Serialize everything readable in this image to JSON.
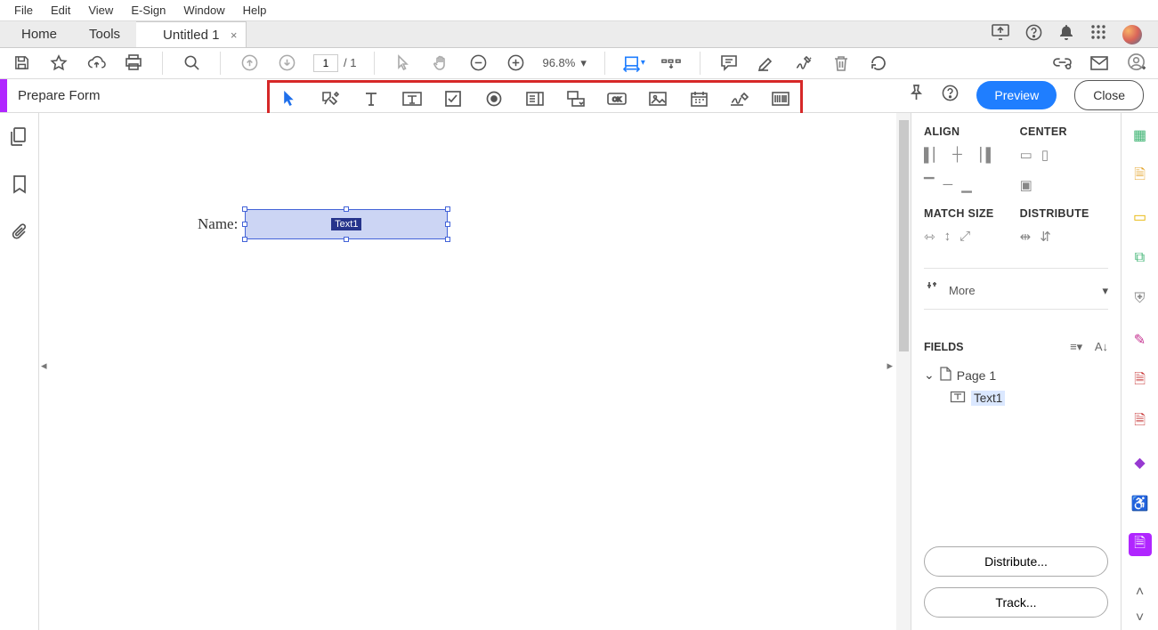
{
  "menu": {
    "file": "File",
    "edit": "Edit",
    "view": "View",
    "esign": "E-Sign",
    "window": "Window",
    "help": "Help"
  },
  "tabs": {
    "home": "Home",
    "tools": "Tools",
    "doc": "Untitled 1"
  },
  "toolbar": {
    "page_current": "1",
    "page_total": "/  1",
    "zoom": "96.8%"
  },
  "form": {
    "title": "Prepare Form",
    "preview": "Preview",
    "close": "Close"
  },
  "canvas": {
    "label": "Name:",
    "field_tag": "Text1"
  },
  "panel": {
    "align": "ALIGN",
    "center": "CENTER",
    "match": "MATCH SIZE",
    "distribute": "DISTRIBUTE",
    "more": "More",
    "fields": "FIELDS",
    "page": "Page 1",
    "field1": "Text1",
    "distributeBtn": "Distribute...",
    "trackBtn": "Track..."
  }
}
